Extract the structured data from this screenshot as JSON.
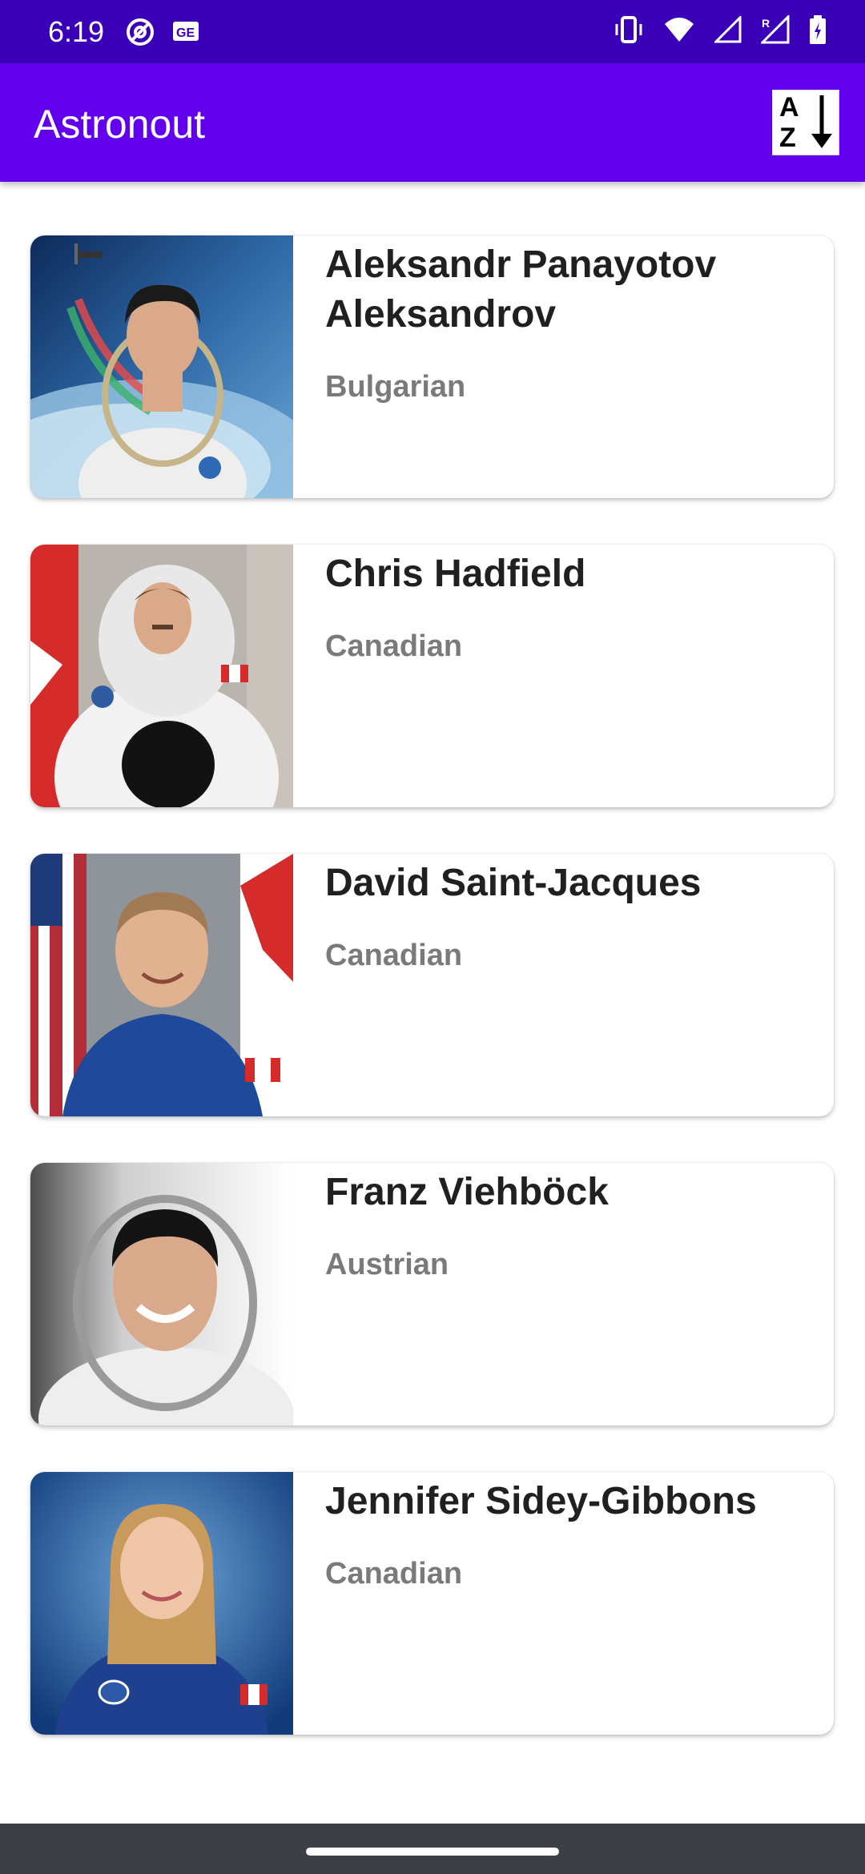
{
  "status_bar": {
    "time": "6:19",
    "left_icons": [
      "at-sign-icon",
      "notification-card-icon"
    ],
    "right_icons": [
      "vibrate-icon",
      "wifi-icon",
      "signal-icon",
      "signal-roaming-icon",
      "battery-charging-icon"
    ]
  },
  "app_bar": {
    "title": "Astronout",
    "sort_button": {
      "letter_top": "A",
      "letter_bottom": "Z",
      "icon": "sort-az-icon"
    }
  },
  "astronauts": [
    {
      "name": "Aleksandr Panayotov Aleksandrov",
      "nationality": "Bulgarian",
      "photo": "cosmonaut-with-earth-background"
    },
    {
      "name": "Chris Hadfield",
      "nationality": "Canadian",
      "photo": "astronaut-spacesuit-canada-flag"
    },
    {
      "name": "David Saint-Jacques",
      "nationality": "Canadian",
      "photo": "astronaut-blue-suit-flags"
    },
    {
      "name": "Franz Viehböck",
      "nationality": "Austrian",
      "photo": "cosmonaut-white-background"
    },
    {
      "name": "Jennifer Sidey-Gibbons",
      "nationality": "Canadian",
      "photo": "astronaut-blue-suit-blue-background"
    }
  ],
  "colors": {
    "status_bar": "#3a00b8",
    "app_bar": "#6200ee",
    "nav_bar": "#3c3f45"
  }
}
